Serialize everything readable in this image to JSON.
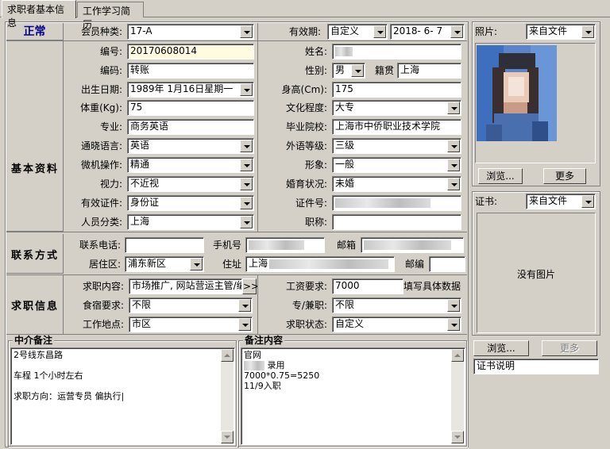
{
  "tabs": [
    {
      "label": "求职者基本信息"
    },
    {
      "label": "工作学习简历"
    }
  ],
  "status": "正常",
  "header": {
    "member_type_label": "会员种类:",
    "member_type_value": "17-A",
    "validity_label": "有效期:",
    "validity_mode": "自定义",
    "validity_date": "2018- 6- 7"
  },
  "sections": {
    "basic": "基本资料",
    "contact": "联系方式",
    "job": "求职信息"
  },
  "basic": {
    "number_label": "编号:",
    "number_value": "20170608014",
    "name_label": "姓名:",
    "code_label": "编码:",
    "code_value": "转账",
    "gender_label": "性别:",
    "gender_value": "男",
    "native_label": "籍贯",
    "native_value": "上海",
    "birth_label": "出生日期:",
    "birth_value": "1989年 1月16日星期一",
    "height_label": "身高(Cm):",
    "height_value": "175",
    "weight_label": "体重(Kg):",
    "weight_value": "75",
    "edu_label": "文化程度:",
    "edu_value": "大专",
    "major_label": "专业:",
    "major_value": "商务英语",
    "school_label": "毕业院校:",
    "school_value": "上海市中侨职业技术学院",
    "lang_label": "通晓语言:",
    "lang_value": "英语",
    "foreign_label": "外语等级:",
    "foreign_value": "三级",
    "computer_label": "微机操作:",
    "computer_value": "精通",
    "image_label": "形象:",
    "image_value": "一般",
    "vision_label": "视力:",
    "vision_value": "不近视",
    "marital_label": "婚育状况:",
    "marital_value": "未婚",
    "cert_type_label": "有效证件:",
    "cert_type_value": "身份证",
    "cert_no_label": "证件号:",
    "category_label": "人员分类:",
    "category_value": "上海",
    "title_label": "职称:"
  },
  "contact": {
    "phone_label": "联系电话:",
    "mobile_label": "手机号",
    "email_label": "邮箱",
    "district_label": "居住区:",
    "district_value": "浦东新区",
    "address_label": "住址",
    "address_prefix": "上海",
    "zip_label": "邮编"
  },
  "job": {
    "content_label": "求职内容:",
    "content_value": "市场推广, 网站营运主管/编",
    "more_btn": ">>",
    "salary_label": "工资要求:",
    "salary_value": "7000",
    "salary_hint": "填写具体数据",
    "board_label": "食宿要求:",
    "board_value": "不限",
    "parttime_label": "专/兼职:",
    "parttime_value": "不限",
    "location_label": "工作地点:",
    "location_value": "市区",
    "state_label": "求职状态:",
    "state_value": "自定义"
  },
  "agency_note": {
    "title": "中介备注",
    "lines": [
      "2号线东昌路",
      "",
      "车程 1个小时左右",
      "",
      "求职方向：运营专员   偏执行|"
    ]
  },
  "remark": {
    "title": "备注内容",
    "lines": [
      "官网",
      "录用",
      "7000*0.75=5250",
      "11/9入职"
    ]
  },
  "photo_panel": {
    "label": "照片:",
    "source": "来自文件",
    "browse": "浏览...",
    "more": "更多"
  },
  "cert_panel": {
    "label": "证书:",
    "source": "来自文件",
    "empty": "没有图片",
    "browse": "浏览...",
    "more": "更多",
    "desc": "证书说明"
  }
}
